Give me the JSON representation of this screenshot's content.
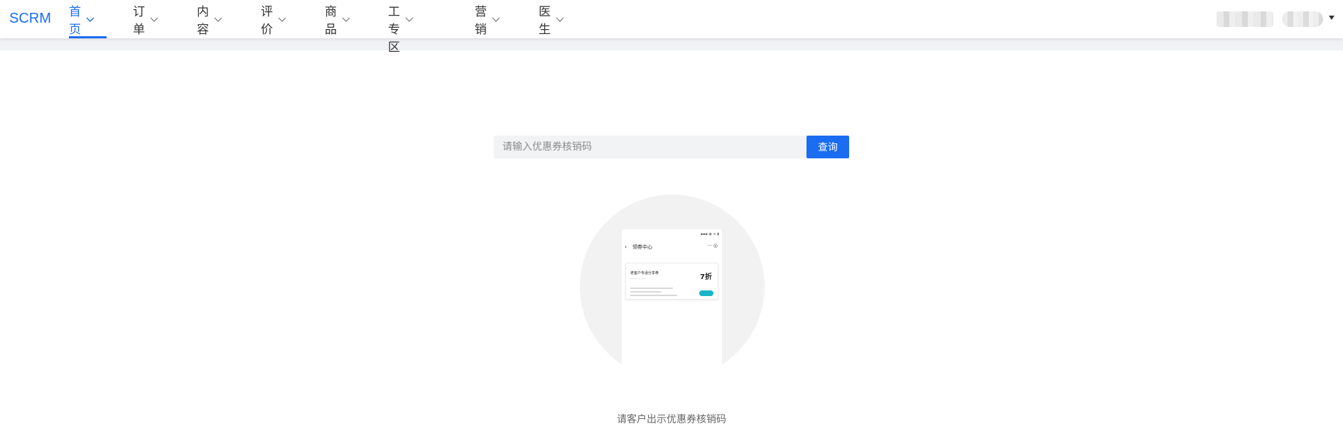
{
  "app": {
    "logo": "SCRM"
  },
  "nav": {
    "items": [
      {
        "label": "首页",
        "active": true
      },
      {
        "label": "订单",
        "active": false
      },
      {
        "label": "内容",
        "active": false
      },
      {
        "label": "评价",
        "active": false
      },
      {
        "label": "商品",
        "active": false
      },
      {
        "label": "员工专区",
        "active": false
      },
      {
        "label": "营销",
        "active": false
      },
      {
        "label": "医生",
        "active": false
      }
    ]
  },
  "search": {
    "placeholder": "请输入优惠券核销码",
    "value": "",
    "button_label": "查询"
  },
  "illustration": {
    "phone_title": "领券中心",
    "coupon_name": "老客户专适分享券",
    "coupon_discount": "7折"
  },
  "hint": "请客户出示优惠券核销码",
  "colors": {
    "accent": "#1a6cf0",
    "subbar_bg": "#f0f2f5",
    "input_bg": "#f2f3f5"
  }
}
